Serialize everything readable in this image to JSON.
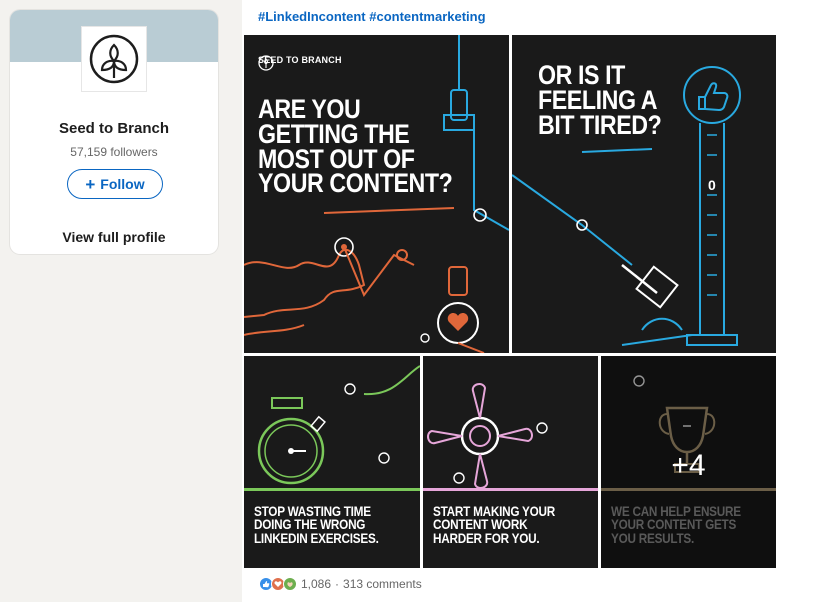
{
  "company": {
    "name": "Seed to Branch",
    "followers": "57,159 followers",
    "follow_label": "Follow",
    "view_profile_label": "View full profile"
  },
  "post": {
    "hashtags": "#LinkedIncontent #contentmarketing",
    "brand_wordmark": "SEED TO BRANCH",
    "main_headline": [
      "ARE YOU",
      "GETTING THE",
      "MOST OUT OF",
      "YOUR CONTENT?"
    ],
    "tired_headline": [
      "OR IS IT",
      "FEELING A",
      "BIT TIRED?"
    ],
    "meter_value": "0",
    "stop_caption": [
      "STOP WASTING TIME",
      "DOING THE WRONG",
      "LINKEDIN EXERCISES."
    ],
    "start_caption": [
      "START MAKING YOUR",
      "CONTENT WORK",
      "HARDER FOR YOU."
    ],
    "help_caption": [
      "WE CAN HELP ENSURE",
      "YOUR CONTENT GETS",
      "YOU RESULTS."
    ],
    "more_images": "+4"
  },
  "social": {
    "reaction_count": "1,086",
    "separator": "·",
    "comments": "313 comments",
    "reaction_icons": [
      "like-icon",
      "love-icon",
      "support-icon"
    ]
  },
  "colors": {
    "linkedin_blue": "#0a66c2",
    "tile_bg": "#1a1a1a",
    "orange": "#e0673a",
    "cyan": "#29a9e0",
    "green": "#7bc85a",
    "pink": "#e6a6d9",
    "gold": "#b9a37a"
  }
}
